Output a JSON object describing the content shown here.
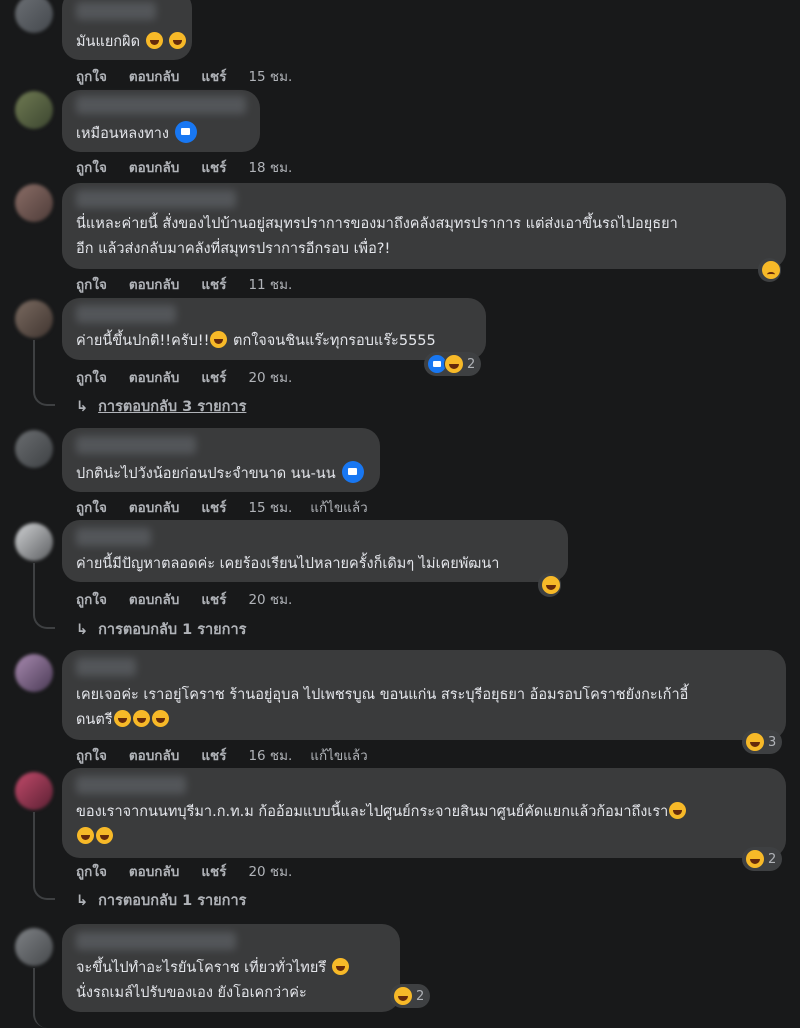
{
  "actions": {
    "like": "ถูกใจ",
    "reply": "ตอบกลับ",
    "share": "แชร์",
    "edited": "แก้ไขแล้ว"
  },
  "comments": [
    {
      "text": "มันแยกผิด",
      "time": "15 ชม."
    },
    {
      "text": "เหมือนหลงทาง",
      "time": "18 ชม."
    },
    {
      "text": "นี่แหละค่ายนี้ สั่งของไปบ้านอยู่สมุทรปราการของมาถึงคลังสมุทรปราการ แต่ส่งเอาขึ้นรถไปอยุธยา\nอีก แล้วส่งกลับมาคลังที่สมุทรปราการอีกรอบ เพื่อ?!",
      "time": "11 ชม."
    },
    {
      "text_a": "ค่ายนี้ขึ้นปกติ!!ครับ!!",
      "text_b": " ตกใจจนชินแร๊ะทุกรอบแร๊ะ5555",
      "time": "20 ชม.",
      "reaction_count": "2",
      "replies": "การตอบกลับ 3 รายการ"
    },
    {
      "text": "ปกติน่ะไปวังน้อยก่อนประจำขนาด นน-นน",
      "time": "15 ชม."
    },
    {
      "text": "ค่ายนี้มีปัญหาตลอดค่ะ เคยร้องเรียนไปหลายครั้งก็เดิมๆ ไม่เคยพัฒนา",
      "time": "20 ชม.",
      "replies": "การตอบกลับ 1 รายการ"
    },
    {
      "text": "เคยเจอค่ะ เราอยู่โคราช ร้านอยู่อุบล ไปเพชรบูณ ขอนแก่น สระบุรีอยุธยา อ้อมรอบโคราชยังกะเก้าอี้\nดนตรี",
      "time": "16 ชม.",
      "reaction_count": "3"
    },
    {
      "text": "ของเราจากนนทบุรีมา.ก.ท.ม ก้ออ้อมแบบนี้และไปศูนย์กระจายสินมาศูนย์คัดแยกแล้วก้อมาถึงเรา",
      "time": "20 ชม.",
      "reaction_count": "2",
      "replies": "การตอบกลับ 1 รายการ"
    },
    {
      "text_a": "จะขึ้นไปทำอะไรยันโคราช เที่ยวทั่วไทยรึ",
      "text_b": "นั่งรถเมล์ไปรับของเอง ยังโอเคกว่าค่ะ",
      "reaction_count": "2"
    }
  ],
  "icons": {
    "like": "like-reaction-icon",
    "laugh": "laugh-reaction-icon",
    "sad": "sad-reaction-icon",
    "reply_arrow": "reply-arrow-icon"
  },
  "colors": {
    "background": "#18191a",
    "bubble": "#3a3b3c",
    "text": "#e4e6eb",
    "muted": "#b0b3b8",
    "like": "#1877f2",
    "emoji": "#f7b928"
  }
}
